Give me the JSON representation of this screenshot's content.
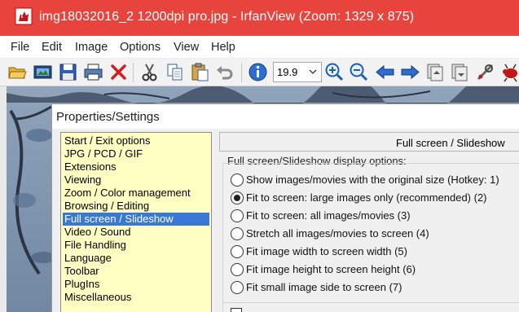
{
  "window": {
    "title": "img18032016_2 1200dpi pro.jpg - IrfanView (Zoom: 1329 x 875)",
    "titlebar_color": "#e7443e",
    "icon": "irfanview-cat-icon"
  },
  "menu": [
    "File",
    "Edit",
    "Image",
    "Options",
    "View",
    "Help"
  ],
  "toolbar": {
    "icons": [
      "open-folder-icon",
      "slideshow-icon",
      "save-icon",
      "print-icon",
      "delete-icon",
      "cut-icon",
      "copy-icon",
      "paste-icon",
      "undo-icon",
      "info-icon",
      "zoom-in-icon",
      "zoom-out-icon",
      "previous-icon",
      "next-icon",
      "first-page-icon",
      "last-page-icon",
      "settings-icon",
      "bug-icon"
    ],
    "zoom_value": "19.9"
  },
  "dialog": {
    "title": "Properties/Settings",
    "categories": [
      "Start / Exit options",
      "JPG / PCD / GIF",
      "Extensions",
      "Viewing",
      "Zoom / Color management",
      "Browsing / Editing",
      "Full screen / Slideshow",
      "Video / Sound",
      "File Handling",
      "Language",
      "Toolbar",
      "PlugIns",
      "Miscellaneous"
    ],
    "selected_category": "Full screen / Slideshow",
    "page_header": "Full screen / Slideshow",
    "group_label": "Full screen/Slideshow display options:",
    "options": [
      {
        "label": "Show images/movies with the original size (Hotkey: 1)",
        "checked": false
      },
      {
        "label": "Fit to screen: large images only (recommended) (2)",
        "checked": true
      },
      {
        "label": "Fit to screen: all images/movies (3)",
        "checked": false
      },
      {
        "label": "Stretch all images/movies to screen (4)",
        "checked": false
      },
      {
        "label": "Fit image width to screen width (5)",
        "checked": false
      },
      {
        "label": "Fit image height to screen height (6)",
        "checked": false
      },
      {
        "label": "Fit small image side to screen (7)",
        "checked": false
      }
    ]
  },
  "colors": {
    "selection": "#3a78d8",
    "list_background": "#ffffc4"
  }
}
